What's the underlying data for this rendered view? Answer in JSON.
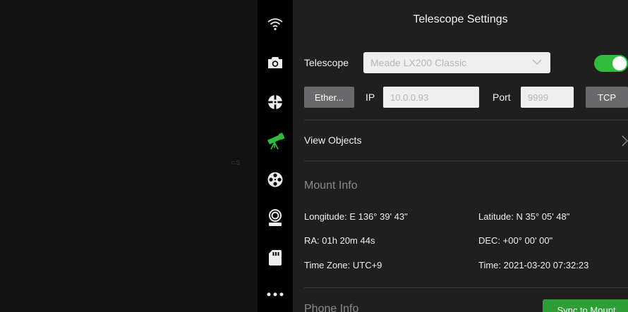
{
  "viewport": {
    "mark": "⊂S"
  },
  "toolbar": {
    "items": [
      {
        "icon": "wifi-icon"
      },
      {
        "icon": "camera-icon"
      },
      {
        "icon": "crosshair-icon"
      },
      {
        "icon": "telescope-icon"
      },
      {
        "icon": "film-reel-icon"
      },
      {
        "icon": "focuser-icon"
      },
      {
        "icon": "sd-card-icon"
      },
      {
        "icon": "more-icon"
      }
    ],
    "active_index": 3,
    "active_color": "#2fbd3b"
  },
  "settings": {
    "title": "Telescope Settings",
    "telescope": {
      "label": "Telescope",
      "selected": "Meade LX200 Classic",
      "enabled": true
    },
    "connection": {
      "type_label": "Ether...",
      "ip_label": "IP",
      "ip_value": "10.0.0.93",
      "port_label": "Port",
      "port_value": "9999",
      "protocol_label": "TCP"
    },
    "view_objects": "View Objects",
    "mount_info": {
      "heading": "Mount Info",
      "longitude": "Longitude: E 136° 39' 43\"",
      "latitude": "Latitude: N 35° 05' 48\"",
      "ra": "RA: 01h 20m 44s",
      "dec": "DEC: +00° 00' 00\"",
      "time_zone": "Time Zone: UTC+9",
      "time": "Time: 2021-03-20 07:32:23"
    },
    "phone_info": {
      "heading": "Phone Info"
    },
    "sync_button": "Sync to Mount"
  },
  "colors": {
    "accent_green": "#2fbd3b",
    "panel_bg": "#1f1f20"
  }
}
